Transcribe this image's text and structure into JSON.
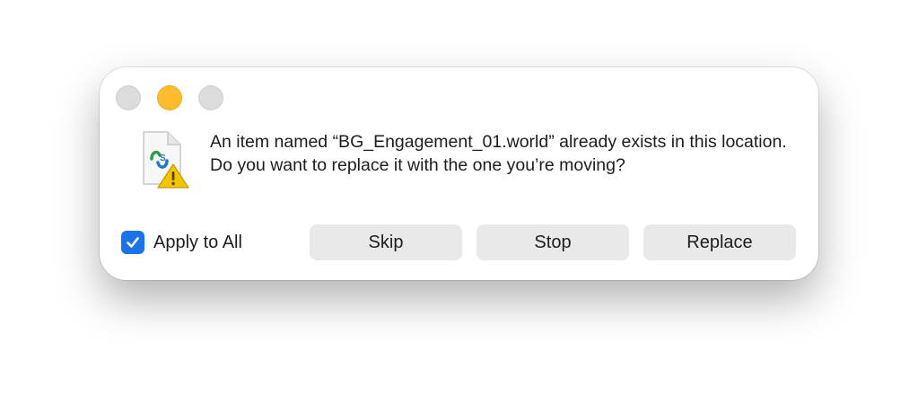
{
  "dialog": {
    "message": "An item named “BG_Engagement_01.world” already exists in this location. Do you want to replace it with the one you’re moving?",
    "file_icon": "document-warning-icon",
    "file_badge_text": "S↕S"
  },
  "window_controls": {
    "close": "close-icon",
    "minimize": "minimize-icon",
    "zoom": "zoom-icon",
    "active_color": "#febc2e"
  },
  "options": {
    "apply_to_all_label": "Apply to All",
    "apply_to_all_checked": true
  },
  "buttons": {
    "skip_label": "Skip",
    "stop_label": "Stop",
    "replace_label": "Replace"
  },
  "colors": {
    "accent": "#1a73e8",
    "button_bg": "#e9e9ea",
    "warning": "#f5c400"
  }
}
